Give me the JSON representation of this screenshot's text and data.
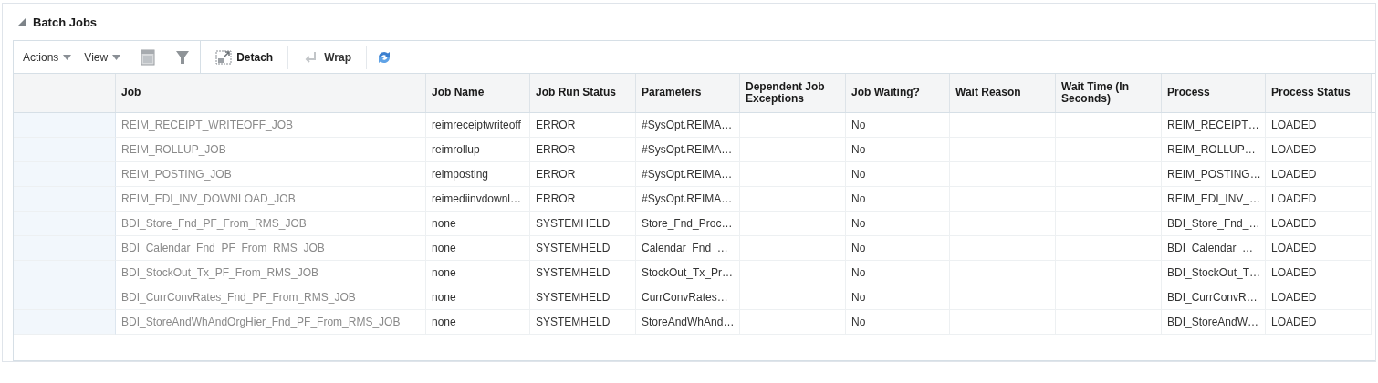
{
  "panel": {
    "title": "Batch Jobs",
    "expanded": true
  },
  "toolbar": {
    "menus": [
      "Actions",
      "View"
    ],
    "buttons": [
      {
        "kind": "export"
      },
      {
        "kind": "filter"
      },
      {
        "kind": "detach",
        "label": "Detach",
        "disabled": false
      },
      {
        "kind": "wrap",
        "label": "Wrap",
        "disabled": true
      },
      {
        "kind": "refresh"
      }
    ]
  },
  "table": {
    "columns": [
      "Job",
      "Job Name",
      "Job Run Status",
      "Parameters",
      "Dependent Job Exceptions",
      "Job Waiting?",
      "Wait Reason",
      "Wait Time (In Seconds)",
      "Process",
      "Process Status"
    ],
    "rows": [
      [
        "REIM_RECEIPT_WRITEOFF_JOB",
        "reimreceiptwriteoff",
        "ERROR",
        "#SysOpt.REIMA…",
        "",
        "No",
        "",
        "",
        "REIM_RECEIPT…",
        "LOADED"
      ],
      [
        "REIM_ROLLUP_JOB",
        "reimrollup",
        "ERROR",
        "#SysOpt.REIMA…",
        "",
        "No",
        "",
        "",
        "REIM_ROLLUP…",
        "LOADED"
      ],
      [
        "REIM_POSTING_JOB",
        "reimposting",
        "ERROR",
        "#SysOpt.REIMA…",
        "",
        "No",
        "",
        "",
        "REIM_POSTING…",
        "LOADED"
      ],
      [
        "REIM_EDI_INV_DOWNLOAD_JOB",
        "reimediinvdownl…",
        "ERROR",
        "#SysOpt.REIMA…",
        "",
        "No",
        "",
        "",
        "REIM_EDI_INV_…",
        "LOADED"
      ],
      [
        "BDI_Store_Fnd_PF_From_RMS_JOB",
        "none",
        "SYSTEMHELD",
        "Store_Fnd_Proc…",
        "",
        "No",
        "",
        "",
        "BDI_Store_Fnd_…",
        "LOADED"
      ],
      [
        "BDI_Calendar_Fnd_PF_From_RMS_JOB",
        "none",
        "SYSTEMHELD",
        "Calendar_Fnd_…",
        "",
        "No",
        "",
        "",
        "BDI_Calendar_…",
        "LOADED"
      ],
      [
        "BDI_StockOut_Tx_PF_From_RMS_JOB",
        "none",
        "SYSTEMHELD",
        "StockOut_Tx_Pr…",
        "",
        "No",
        "",
        "",
        "BDI_StockOut_T…",
        "LOADED"
      ],
      [
        "BDI_CurrConvRates_Fnd_PF_From_RMS_JOB",
        "none",
        "SYSTEMHELD",
        "CurrConvRates…",
        "",
        "No",
        "",
        "",
        "BDI_CurrConvR…",
        "LOADED"
      ],
      [
        "BDI_StoreAndWhAndOrgHier_Fnd_PF_From_RMS_JOB",
        "none",
        "SYSTEMHELD",
        "StoreAndWhAnd…",
        "",
        "No",
        "",
        "",
        "BDI_StoreAndW…",
        "LOADED"
      ]
    ]
  }
}
